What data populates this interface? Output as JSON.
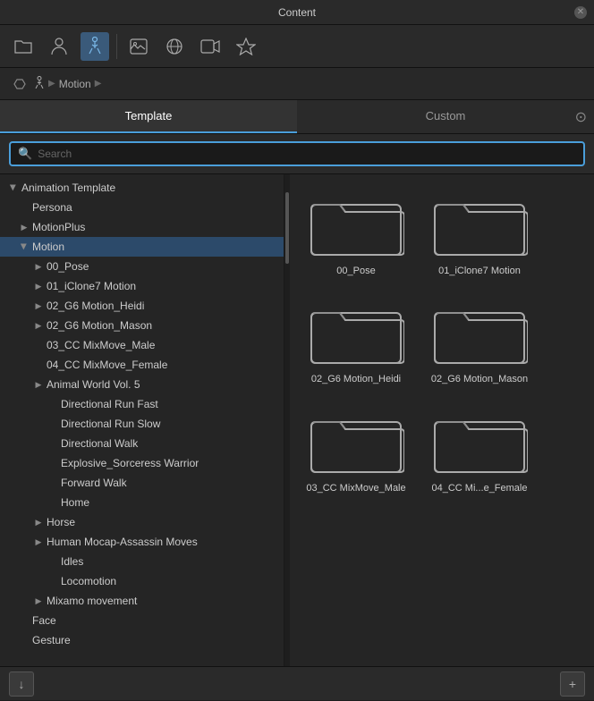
{
  "titleBar": {
    "title": "Content"
  },
  "toolbar": {
    "icons": [
      {
        "name": "folder-icon",
        "symbol": "🗂",
        "active": false
      },
      {
        "name": "person-icon",
        "symbol": "👤",
        "active": false
      },
      {
        "name": "figure-icon",
        "symbol": "🏃",
        "active": true
      },
      {
        "name": "image-icon",
        "symbol": "🖼",
        "active": false
      },
      {
        "name": "sphere-icon",
        "symbol": "⬡",
        "active": false
      },
      {
        "name": "video-icon",
        "symbol": "🎞",
        "active": false
      },
      {
        "name": "props-icon",
        "symbol": "🪄",
        "active": false
      }
    ]
  },
  "breadcrumb": {
    "back_label": "←",
    "items": [
      "Motion",
      "▶"
    ]
  },
  "tabs": {
    "template_label": "Template",
    "custom_label": "Custom",
    "active": "template"
  },
  "search": {
    "placeholder": "Search"
  },
  "tree": {
    "items": [
      {
        "id": "anim-template",
        "label": "Animation Template",
        "level": 1,
        "arrow": "▼",
        "arrowOpen": true
      },
      {
        "id": "persona",
        "label": "Persona",
        "level": 2,
        "arrow": null
      },
      {
        "id": "motionplus",
        "label": "MotionPlus",
        "level": 2,
        "arrow": "▶",
        "arrowOpen": false
      },
      {
        "id": "motion",
        "label": "Motion",
        "level": 2,
        "arrow": "▼",
        "arrowOpen": true,
        "selected": true
      },
      {
        "id": "pose",
        "label": "00_Pose",
        "level": 3,
        "arrow": "▶",
        "arrowOpen": false
      },
      {
        "id": "iclone7",
        "label": "01_iClone7 Motion",
        "level": 3,
        "arrow": "▶",
        "arrowOpen": false
      },
      {
        "id": "heidi",
        "label": "02_G6 Motion_Heidi",
        "level": 3,
        "arrow": "▶",
        "arrowOpen": false
      },
      {
        "id": "mason",
        "label": "02_G6 Motion_Mason",
        "level": 3,
        "arrow": "▶",
        "arrowOpen": false
      },
      {
        "id": "mixmove-male",
        "label": "03_CC MixMove_Male",
        "level": 3,
        "arrow": null
      },
      {
        "id": "mixmove-female",
        "label": "04_CC MixMove_Female",
        "level": 3,
        "arrow": null
      },
      {
        "id": "animal-world",
        "label": "Animal World Vol. 5",
        "level": 3,
        "arrow": "▶",
        "arrowOpen": false
      },
      {
        "id": "dir-run-fast",
        "label": "Directional Run Fast",
        "level": 4,
        "arrow": null
      },
      {
        "id": "dir-run-slow",
        "label": "Directional Run Slow",
        "level": 4,
        "arrow": null
      },
      {
        "id": "dir-walk",
        "label": "Directional Walk",
        "level": 4,
        "arrow": null
      },
      {
        "id": "explosive",
        "label": "Explosive_Sorceress Warrior",
        "level": 4,
        "arrow": null
      },
      {
        "id": "forward-walk",
        "label": "Forward Walk",
        "level": 4,
        "arrow": null
      },
      {
        "id": "home",
        "label": "Home",
        "level": 4,
        "arrow": null
      },
      {
        "id": "horse",
        "label": "Horse",
        "level": 3,
        "arrow": "▶",
        "arrowOpen": false
      },
      {
        "id": "mocap-assassin",
        "label": "Human Mocap-Assassin Moves",
        "level": 3,
        "arrow": "▶",
        "arrowOpen": false
      },
      {
        "id": "idles",
        "label": "Idles",
        "level": 4,
        "arrow": null
      },
      {
        "id": "locomotion",
        "label": "Locomotion",
        "level": 4,
        "arrow": null
      },
      {
        "id": "mixamo",
        "label": "Mixamo movement",
        "level": 3,
        "arrow": "▶",
        "arrowOpen": false
      },
      {
        "id": "face",
        "label": "Face",
        "level": 2,
        "arrow": null
      },
      {
        "id": "gesture",
        "label": "Gesture",
        "level": 2,
        "arrow": null
      }
    ]
  },
  "grid": {
    "folders": [
      {
        "id": "f-pose",
        "label": "00_Pose"
      },
      {
        "id": "f-iclone7",
        "label": "01_iClone7 Motion"
      },
      {
        "id": "f-heidi",
        "label": "02_G6 Motion_Heidi"
      },
      {
        "id": "f-mason",
        "label": "02_G6 Motion_Mason"
      },
      {
        "id": "f-mixmove-male",
        "label": "03_CC MixMove_Male"
      },
      {
        "id": "f-mixmove-female",
        "label": "04_CC Mi...e_Female"
      }
    ]
  },
  "bottomBar": {
    "left_button": "↓",
    "right_button": "+"
  }
}
